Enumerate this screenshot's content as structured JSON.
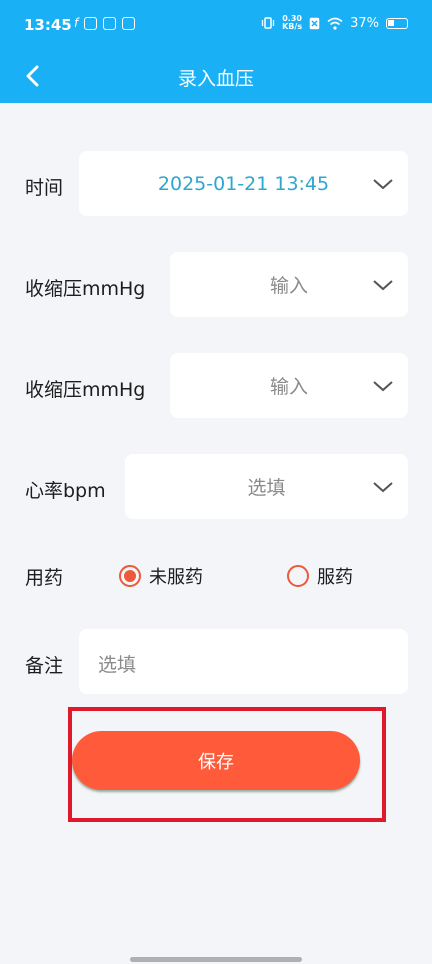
{
  "status_bar": {
    "time": "13:45",
    "net_speed_top": "0.30",
    "net_speed_bottom": "KB/s",
    "battery_percent": "37%"
  },
  "header": {
    "title": "录入血压",
    "back_icon": "chevron-left-icon",
    "color": "#1ab0f5"
  },
  "form": {
    "time": {
      "label": "时间",
      "value": "2025-01-21 13:45"
    },
    "systolic": {
      "label": "收缩压mmHg",
      "placeholder": "输入"
    },
    "diastolic": {
      "label": "收缩压mmHg",
      "placeholder": "输入"
    },
    "heart_rate": {
      "label": "心率bpm",
      "placeholder": "选填"
    },
    "medication": {
      "label": "用药",
      "options": [
        {
          "label": "未服药",
          "selected": true
        },
        {
          "label": "服药",
          "selected": false
        }
      ]
    },
    "notes": {
      "label": "备注",
      "placeholder": "选填"
    }
  },
  "save_button": {
    "label": "保存",
    "color": "#ff5b3a"
  },
  "highlight_color": "#e0182c"
}
